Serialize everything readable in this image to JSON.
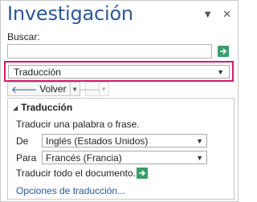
{
  "pane": {
    "title": "Investigación",
    "menu_glyph": "▼",
    "close_glyph": "✕"
  },
  "search": {
    "label": "Buscar:",
    "value": "",
    "placeholder": ""
  },
  "service": {
    "selected": "Traducción",
    "caret": "▼"
  },
  "nav": {
    "back_label": "Volver",
    "back_glyph": "🡐",
    "forward_glyph": "🡒",
    "dropdown_glyph": "▼"
  },
  "translation": {
    "section_title": "Traducción",
    "collapse_glyph": "◢",
    "instruction": "Traducir una palabra o frase.",
    "from_label": "De",
    "from_value": "Inglés (Estados Unidos)",
    "to_label": "Para",
    "to_value": "Francés (Francia)",
    "document_text": "Traducir todo el documento.",
    "options_link": "Opciones de traducción..."
  },
  "colors": {
    "accent": "#2b579a",
    "go_green": "#3a9e6a",
    "highlight": "#d4186c"
  }
}
